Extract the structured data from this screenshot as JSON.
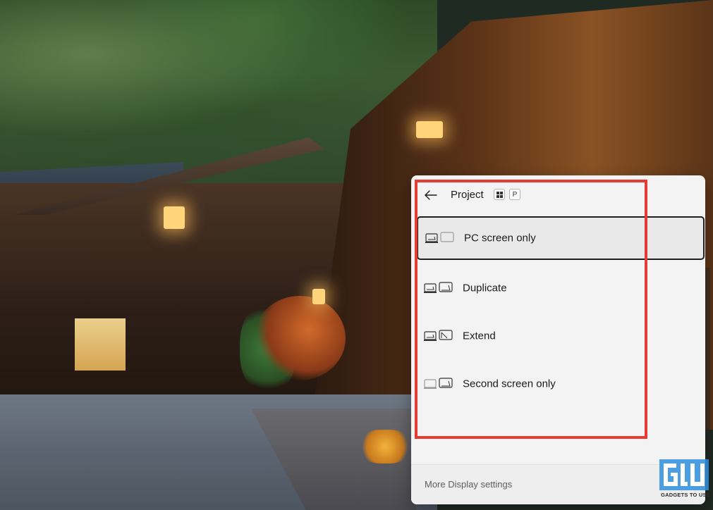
{
  "flyout": {
    "title": "Project",
    "shortcut_key": "P",
    "options": [
      {
        "label": "PC screen only",
        "icon": "pc-screen-only-icon",
        "selected": true
      },
      {
        "label": "Duplicate",
        "icon": "duplicate-icon",
        "selected": false
      },
      {
        "label": "Extend",
        "icon": "extend-icon",
        "selected": false
      },
      {
        "label": "Second screen only",
        "icon": "second-screen-only-icon",
        "selected": false
      }
    ],
    "footer_link": "More Display settings"
  },
  "watermark": {
    "text": "GADGETS TO USE",
    "logo": "GTU"
  },
  "colors": {
    "flyout_bg": "#f3f3f3",
    "highlight": "#e53b33",
    "selected_border": "#1f1f1f",
    "watermark_blue": "#2f8fe0"
  }
}
